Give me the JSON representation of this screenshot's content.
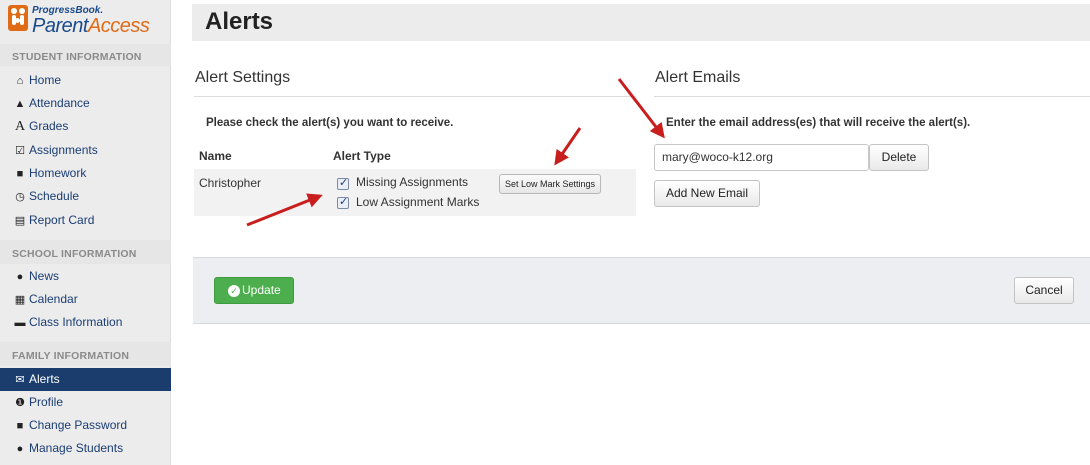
{
  "app": {
    "logo_small": "ProgressBook.",
    "logo_main_a": "Parent",
    "logo_main_b": "Access"
  },
  "sidebar": {
    "sections": [
      {
        "title": "STUDENT INFORMATION"
      },
      {
        "title": "SCHOOL INFORMATION"
      },
      {
        "title": "FAMILY INFORMATION"
      }
    ],
    "items": [
      {
        "label": "Home",
        "icon": "home-icon"
      },
      {
        "label": "Attendance",
        "icon": "bell-icon"
      },
      {
        "label": "Grades",
        "icon": "grades-a-icon"
      },
      {
        "label": "Assignments",
        "icon": "check-square-icon"
      },
      {
        "label": "Homework",
        "icon": "book-icon"
      },
      {
        "label": "Schedule",
        "icon": "clock-icon"
      },
      {
        "label": "Report Card",
        "icon": "report-card-icon"
      },
      {
        "label": "News",
        "icon": "globe-icon"
      },
      {
        "label": "Calendar",
        "icon": "calendar-icon"
      },
      {
        "label": "Class Information",
        "icon": "comment-icon"
      },
      {
        "label": "Alerts",
        "icon": "envelope-icon",
        "active": true
      },
      {
        "label": "Profile",
        "icon": "info-icon"
      },
      {
        "label": "Change Password",
        "icon": "lock-icon"
      },
      {
        "label": "Manage Students",
        "icon": "user-icon"
      }
    ]
  },
  "page": {
    "title": "Alerts"
  },
  "alert_settings": {
    "title": "Alert Settings",
    "instruction": "Please check the alert(s) you want to receive.",
    "col_name": "Name",
    "col_type": "Alert Type",
    "row": {
      "student": "Christopher",
      "alerts": [
        {
          "label": "Missing Assignments",
          "checked": true
        },
        {
          "label": "Low Assignment Marks",
          "checked": true
        }
      ],
      "low_mark_button": "Set Low Mark Settings"
    }
  },
  "alert_emails": {
    "title": "Alert Emails",
    "instruction": "Enter the email address(es) that will receive the alert(s).",
    "emails": [
      {
        "value": "mary@woco-k12.org",
        "delete_label": "Delete"
      }
    ],
    "add_label": "Add New Email"
  },
  "actions": {
    "update_label": "Update",
    "cancel_label": "Cancel"
  },
  "colors": {
    "active_nav": "#1b3d6e",
    "update_green": "#4cae4c",
    "arrow_red": "#c81e1e",
    "accent_orange": "#e06b16"
  }
}
